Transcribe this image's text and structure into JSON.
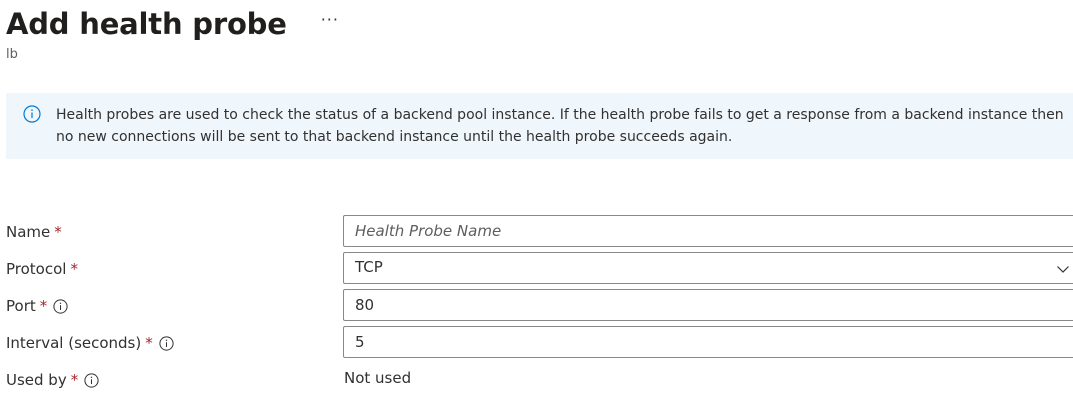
{
  "header": {
    "title": "Add health probe",
    "more_label": "···",
    "subtitle": "lb"
  },
  "info_banner": {
    "icon": "info-icon",
    "text": "Health probes are used to check the status of a backend pool instance. If the health probe fails to get a response from a backend instance then no new connections will be sent to that backend instance until the health probe succeeds again."
  },
  "form": {
    "required_marker": "*",
    "name": {
      "label": "Name",
      "value": "",
      "placeholder": "Health Probe Name"
    },
    "protocol": {
      "label": "Protocol",
      "value": "TCP"
    },
    "port": {
      "label": "Port",
      "value": "80"
    },
    "interval": {
      "label": "Interval (seconds)",
      "value": "5"
    },
    "used_by": {
      "label": "Used by",
      "value": "Not used"
    }
  },
  "colors": {
    "banner_bg": "#eff6fc",
    "info_blue": "#0078d4",
    "required_red": "#a4262c",
    "border": "#8a8886"
  }
}
